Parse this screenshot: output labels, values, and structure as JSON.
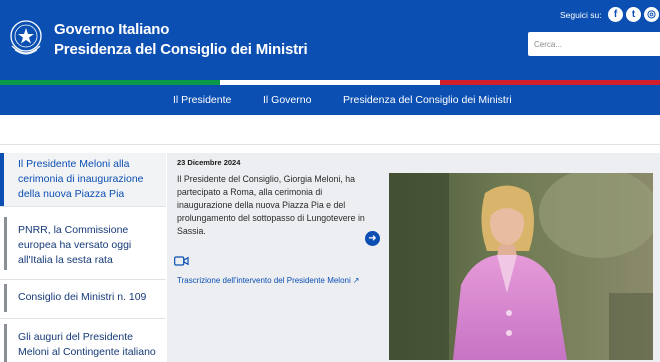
{
  "header": {
    "title_line1": "Governo Italiano",
    "title_line2": "Presidenza del Consiglio dei Ministri",
    "follow_label": "Seguici su:",
    "social": [
      {
        "icon": "facebook-icon",
        "glyph": "f"
      },
      {
        "icon": "twitter-icon",
        "glyph": "t"
      },
      {
        "icon": "instagram-icon",
        "glyph": "◎"
      }
    ],
    "search_placeholder": "Cerca...",
    "brand_color": "#0b4fb3"
  },
  "flag_colors": [
    "#0a9a47",
    "#ffffff",
    "#d21f2b"
  ],
  "nav": {
    "items": [
      "Il Presidente",
      "Il Governo",
      "Presidenza del Consiglio dei Ministri"
    ]
  },
  "news": {
    "items": [
      "Il Presidente Meloni alla cerimonia di inaugurazione della nuova Piazza Pia",
      "PNRR, la Commissione europea ha versato oggi all'Italia la sesta rata",
      "Consiglio dei Ministri n. 109",
      "Gli auguri del Presidente Meloni al Contingente italiano in Lituania e"
    ],
    "active_index": 0
  },
  "feature": {
    "date": "23 Dicembre 2024",
    "text": "Il Presidente del Consiglio, Giorgia Meloni, ha partecipato a Roma, alla cerimonia di inaugurazione della nuova Piazza Pia e del prolungamento del sottopasso di Lungotevere in Sassia.",
    "link_label": "Trascrizione dell'intervento del Presidente Meloni",
    "link_icon": "external-link-icon",
    "arrow_icon": "arrow-right-icon",
    "video_icon": "video-camera-icon"
  }
}
